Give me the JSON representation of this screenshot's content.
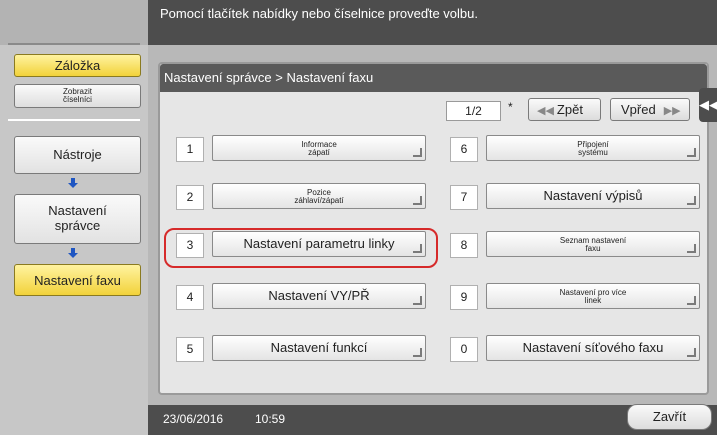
{
  "header": {
    "message": "Pomocí tlačítek nabídky nebo číselnice proveďte volbu."
  },
  "left": {
    "bookmark": "Záložka",
    "show_numbers_line1": "Zobrazit",
    "show_numbers_line2": "číselníci",
    "tools": "Nástroje",
    "admin_line1": "Nastavení",
    "admin_line2": "správce",
    "fax": "Nastavení faxu"
  },
  "panel": {
    "breadcrumb": "Nastavení správce > Nastavení faxu",
    "page": "1/2",
    "star": "*",
    "back": "Zpět",
    "forward": "Vpřed",
    "items": [
      {
        "num": "1",
        "label": "Informace zápatí",
        "small": true
      },
      {
        "num": "6",
        "label": "Připojení systému",
        "small": true
      },
      {
        "num": "2",
        "label": "Pozice záhlaví/zápatí",
        "small": true
      },
      {
        "num": "7",
        "label": "Nastavení výpisů",
        "small": false
      },
      {
        "num": "3",
        "label": "Nastavení parametru linky",
        "small": false
      },
      {
        "num": "8",
        "label": "Seznam nastavení faxu",
        "small": true
      },
      {
        "num": "4",
        "label": "Nastavení VY/PŘ",
        "small": false
      },
      {
        "num": "9",
        "label": "Nastavení pro více linek",
        "small": true
      },
      {
        "num": "5",
        "label": "Nastavení funkcí",
        "small": false
      },
      {
        "num": "0",
        "label": "Nastavení síťového faxu",
        "small": false
      }
    ]
  },
  "footer": {
    "date": "23/06/2016",
    "time": "10:59",
    "close": "Zavřít"
  },
  "icons": {
    "back": "double-left-arrow-icon",
    "forward": "double-right-arrow-icon",
    "side_tab": "double-left-arrow-icon"
  }
}
